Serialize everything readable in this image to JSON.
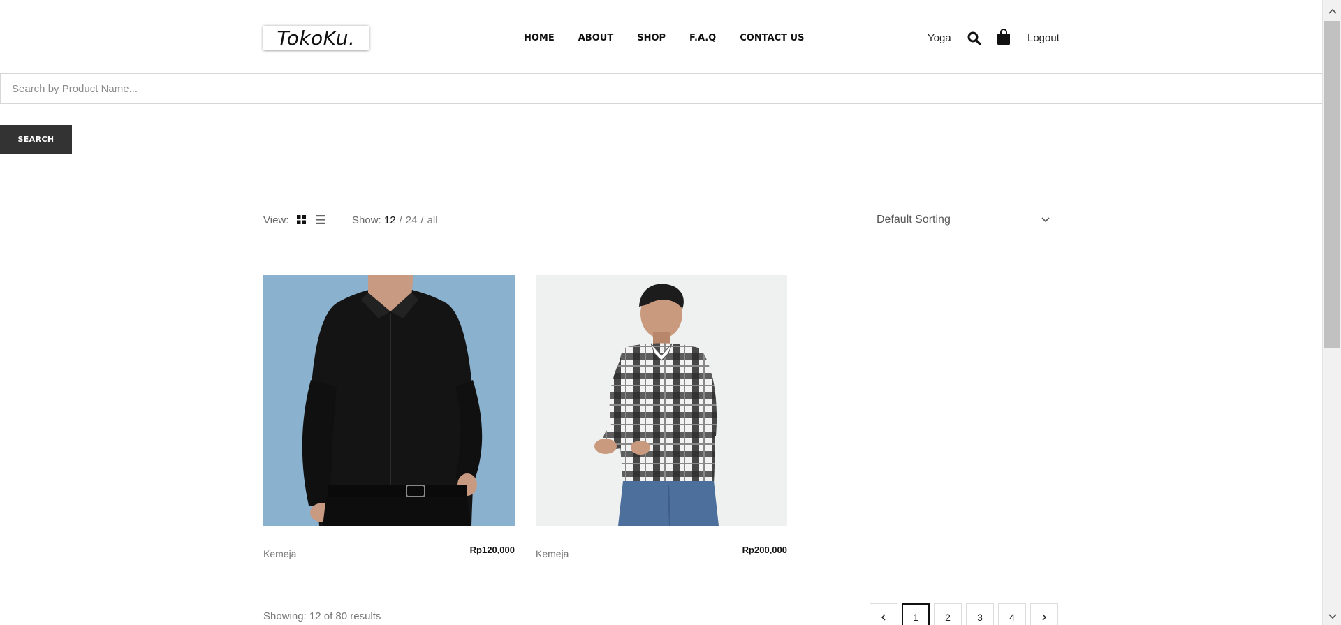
{
  "header": {
    "logo": "TokoKu.",
    "nav": [
      "HOME",
      "ABOUT",
      "SHOP",
      "F.A.Q",
      "CONTACT US"
    ],
    "user_name": "Yoga",
    "logout": "Logout"
  },
  "search": {
    "placeholder": "Search by Product Name...",
    "button_label": "SEARCH"
  },
  "toolbar": {
    "view_label": "View:",
    "show_label": "Show:",
    "show_options": [
      "12",
      "24",
      "all"
    ],
    "show_selected": "12",
    "sorting": "Default Sorting"
  },
  "products": [
    {
      "name": "Kemeja",
      "price": "Rp120,000"
    },
    {
      "name": "Kemeja",
      "price": "Rp200,000"
    }
  ],
  "results": "Showing: 12 of 80 results",
  "pagination": {
    "pages": [
      "1",
      "2",
      "3",
      "4"
    ],
    "current": "1"
  },
  "colors": {
    "search_button_bg": "#333333",
    "product1_bg": "#8ab1cd",
    "product2_bg": "#eef1ef"
  },
  "icons": [
    "search-icon",
    "shopping-bag-icon",
    "grid-view-icon",
    "list-view-icon",
    "chevron-down-icon",
    "chevron-left-icon",
    "chevron-right-icon"
  ]
}
